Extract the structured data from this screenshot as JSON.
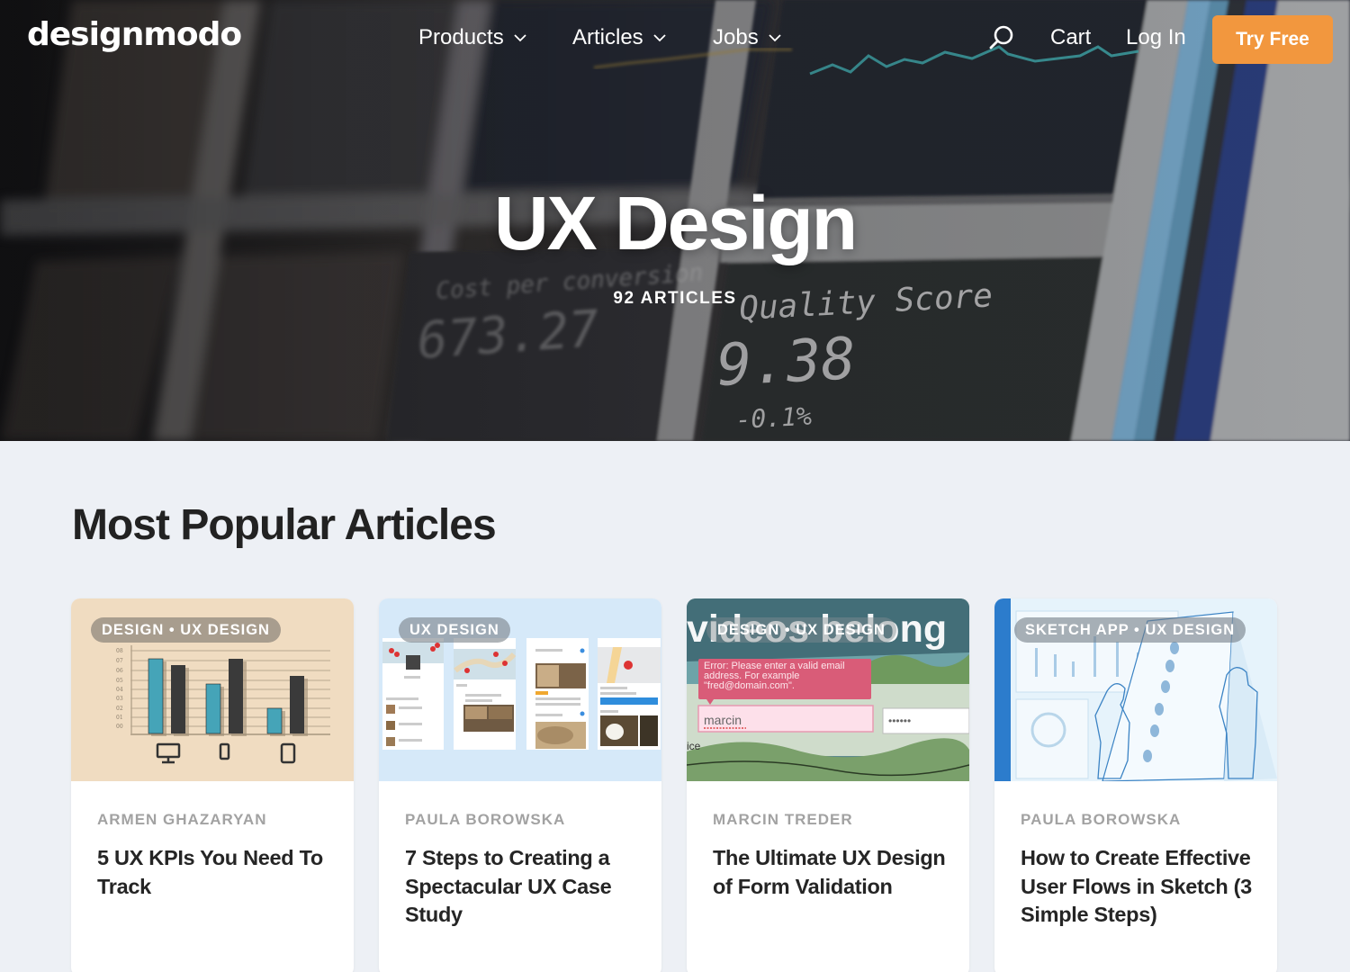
{
  "brand": {
    "logo_text": "designmodo",
    "accent_color": "#f2973e"
  },
  "nav": {
    "items": [
      {
        "label": "Products",
        "has_dropdown": true
      },
      {
        "label": "Articles",
        "has_dropdown": true
      },
      {
        "label": "Jobs",
        "has_dropdown": true
      }
    ],
    "search_icon": "search-icon",
    "cart_label": "Cart",
    "login_label": "Log In",
    "cta_label": "Try Free"
  },
  "hero": {
    "title": "UX Design",
    "subtitle": "92 ARTICLES",
    "background_text": {
      "label1": "Cost per conversion",
      "value1": "673.27",
      "label2": "Quality Score",
      "value2": "9.38",
      "delta2": "-0.1%"
    }
  },
  "section": {
    "title": "Most Popular Articles"
  },
  "cards": [
    {
      "tag": "DESIGN • UX DESIGN",
      "author": "ARMEN GHAZARYAN",
      "title": "5 UX KPIs You Need To Track",
      "image_bg": "#f0dcc1"
    },
    {
      "tag": "UX DESIGN",
      "author": "PAULA BOROWSKA",
      "title": "7 Steps to Creating a Spectacular UX Case Study",
      "image_bg": "#d6e9f9"
    },
    {
      "tag": "DESIGN • UX DESIGN",
      "author": "MARCIN TREDER",
      "title": "The Ultimate UX Design of Form Validation",
      "image_bg": "#5e8a8e",
      "image_text": {
        "headline": "videos belong",
        "error": "Error: Please enter a valid email address. For example \"fred@domain.com\".",
        "input_value": "marcin",
        "password_mask": "••••••",
        "fragment": "ice"
      }
    },
    {
      "tag": "SKETCH APP • UX DESIGN",
      "author": "PAULA BOROWSKA",
      "title": "How to Create Effective User Flows in Sketch (3 Simple Steps)",
      "image_bg": "#e6f3fb"
    }
  ]
}
